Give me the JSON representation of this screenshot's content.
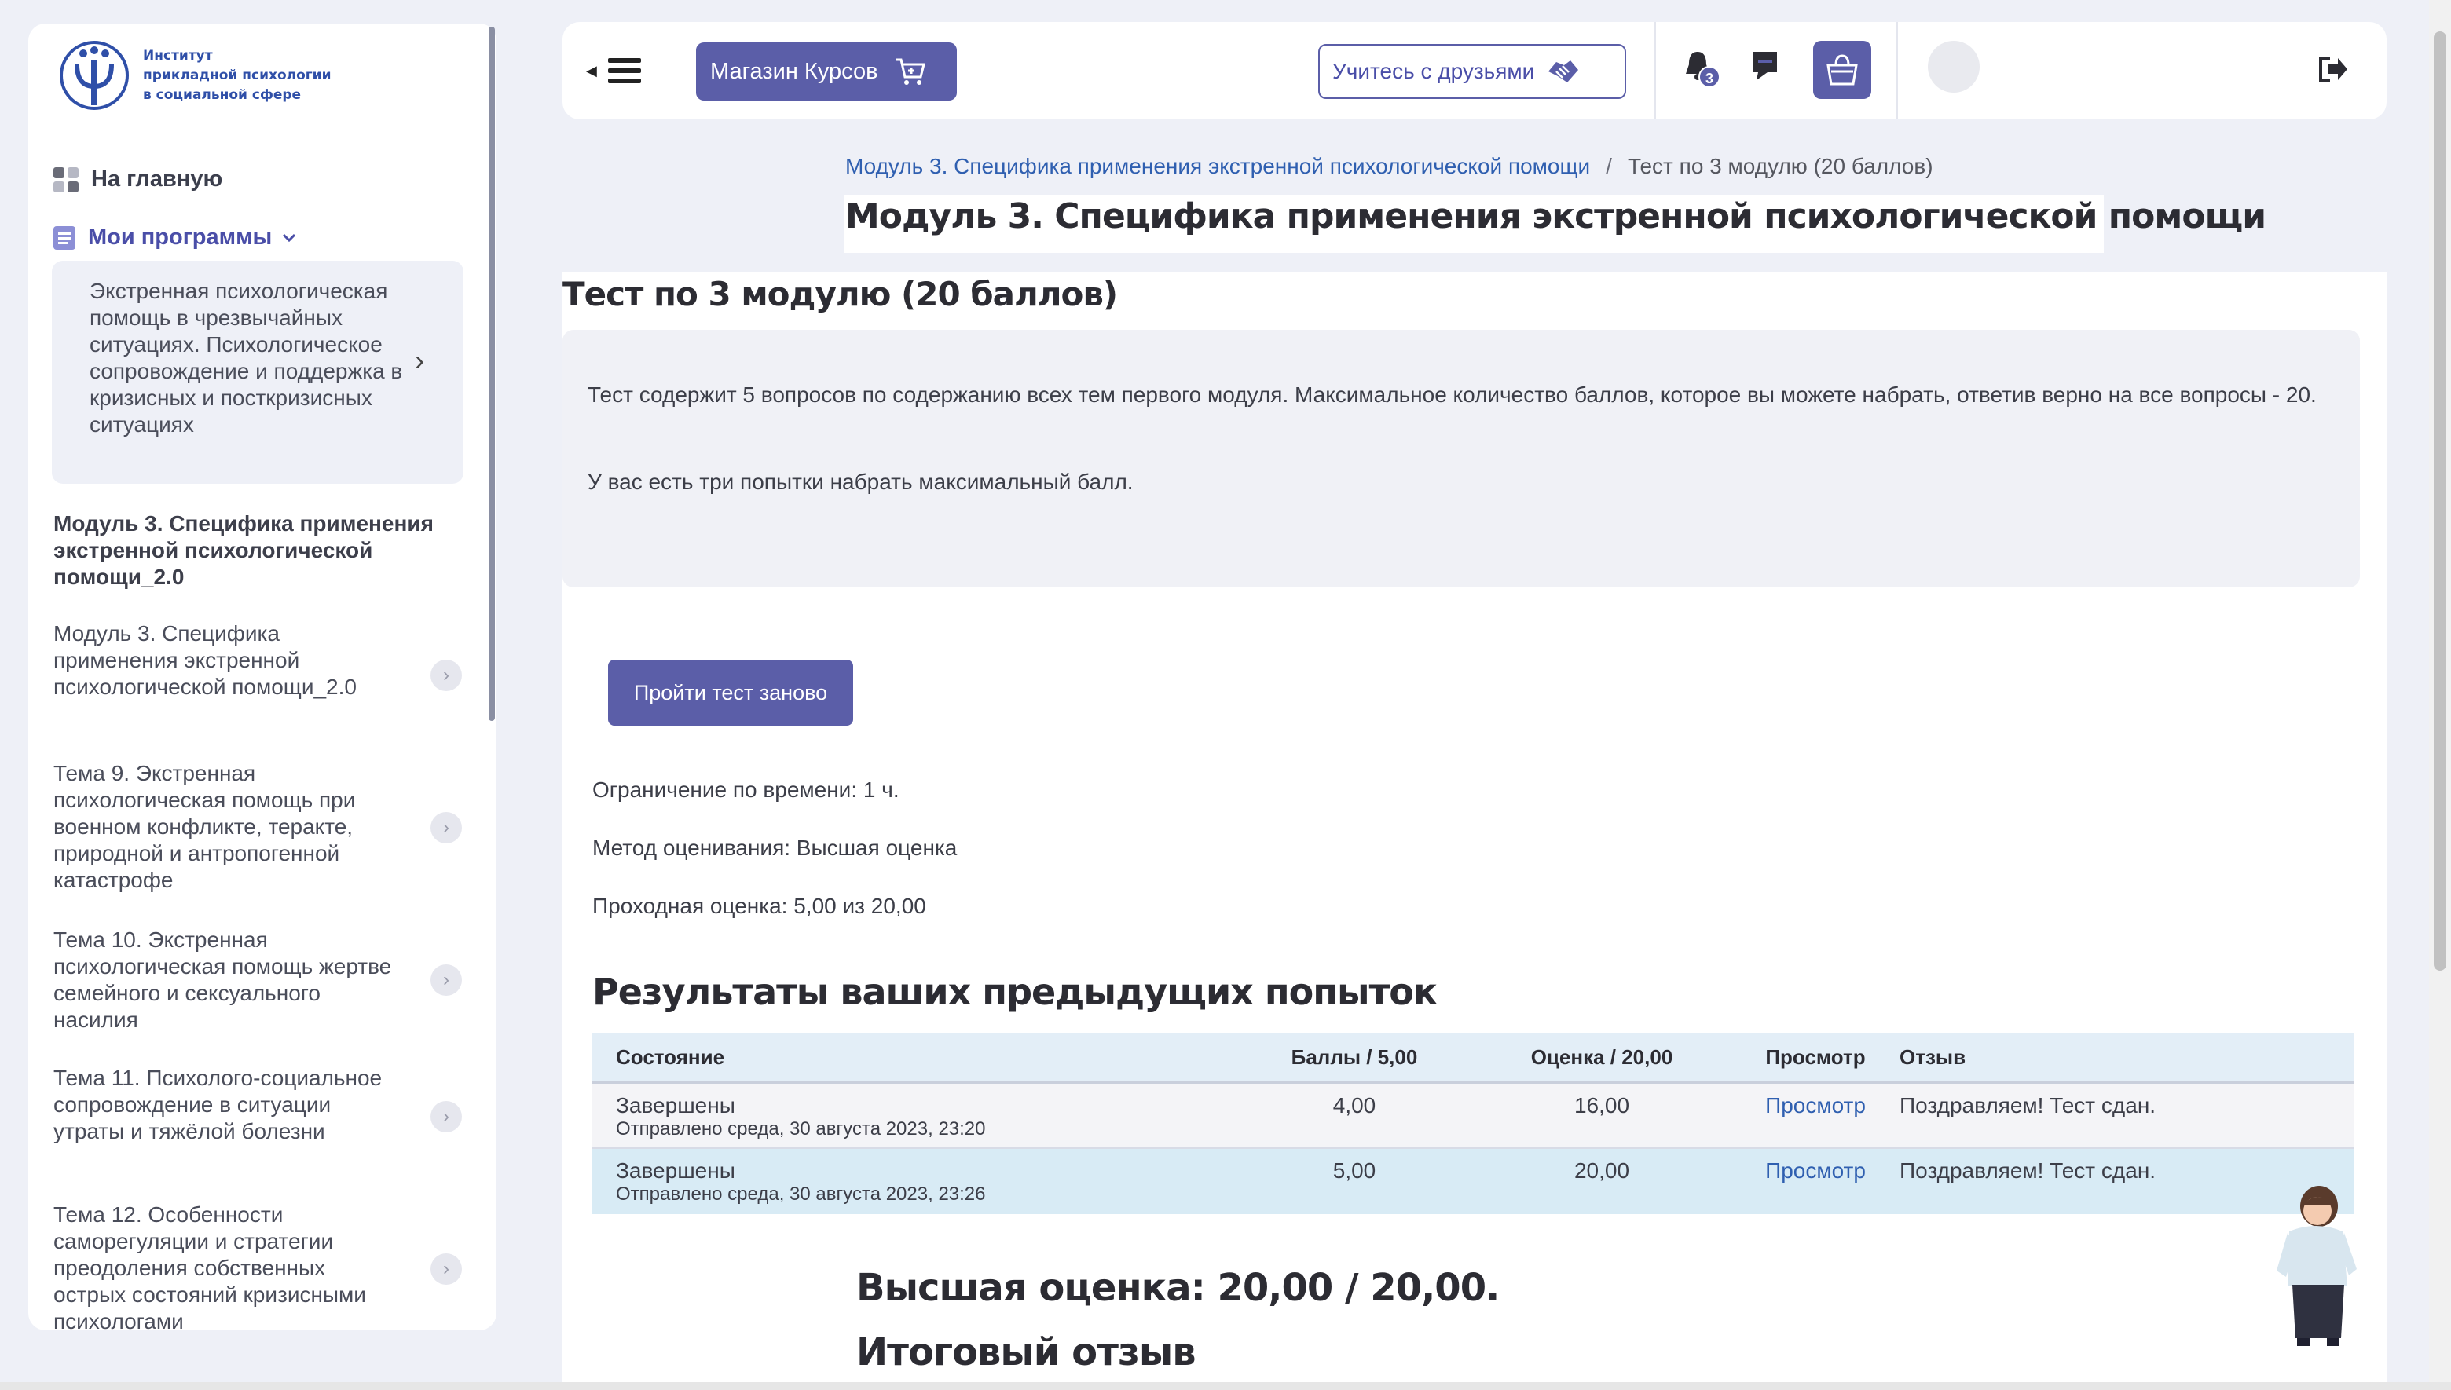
{
  "logo": {
    "lines": [
      "Институт",
      "прикладной психологии",
      "в социальной сфере"
    ]
  },
  "sidebar": {
    "home_label": "На главную",
    "programs_label": "Мои программы",
    "program_title": "Экстренная психологическая помощь в чрезвычайных ситуациях. Психологическое сопровождение и поддержка в кризисных и посткризисных ситуациях",
    "module_title": "Модуль 3. Специфика применения экстренной психологической помощи_2.0",
    "sections": [
      "Модуль 3. Специфика применения экстренной психологической помощи_2.0",
      "Тема 9. Экстренная психологическая помощь при военном конфликте, теракте, природной и антропогенной катастрофе",
      "Тема 10. Экстренная психологическая помощь жертве семейного и сексуального насилия",
      "Тема 11. Психолого-социальное сопровождение в ситуации утраты и тяжёлой болезни",
      "Тема 12. Особенности саморегуляции и стратегии преодоления собственных острых состояний кризисными психологами"
    ]
  },
  "header": {
    "shop_label": "Магазин Курсов",
    "friends_label": "Учитесь с друзьями",
    "notification_count": "3"
  },
  "breadcrumb": {
    "module": "Модуль 3. Специфика применения экстренной психологической помощи",
    "separator": "/",
    "current": "Тест по 3 модулю (20 баллов)"
  },
  "page": {
    "heading": "Модуль 3. Специфика применения экстренной психологической помощи",
    "quiz_title": "Тест по 3 модулю (20 баллов)",
    "intro_1": "Тест содержит 5 вопросов по содержанию всех тем первого модуля. Максимальное количество баллов, которое вы можете набрать, ответив верно на все вопросы - 20.",
    "intro_2": "У вас есть три попытки набрать максимальный балл.",
    "retake_label": "Пройти тест заново",
    "time_limit": "Ограничение по времени: 1 ч.",
    "grading_method": "Метод оценивания: Высшая оценка",
    "passing_grade": "Проходная оценка: 5,00 из 20,00",
    "results_heading": "Результаты ваших предыдущих попыток",
    "best_grade": "Высшая оценка: 20,00 / 20,00.",
    "final_feedback": "Итоговый отзыв"
  },
  "results": {
    "headers": [
      "Состояние",
      "Баллы / 5,00",
      "Оценка / 20,00",
      "Просмотр",
      "Отзыв"
    ],
    "rows": [
      {
        "state": "Завершены",
        "submitted": "Отправлено среда, 30 августа 2023, 23:20",
        "score": "4,00",
        "grade": "16,00",
        "review": "Просмотр",
        "feedback": "Поздравляем! Тест сдан."
      },
      {
        "state": "Завершены",
        "submitted": "Отправлено среда, 30 августа 2023, 23:26",
        "score": "5,00",
        "grade": "20,00",
        "review": "Просмотр",
        "feedback": "Поздравляем! Тест сдан."
      }
    ]
  },
  "colors": {
    "accent": "#5b5ea8",
    "link": "#2f5fb0",
    "background": "#eef0f7",
    "table_header": "#e3eef7",
    "highlight_row": "#d8ebf5"
  },
  "icons": [
    "logo-icon",
    "dashboard-icon",
    "document-icon",
    "chevron-down-icon",
    "chevron-right-icon",
    "hamburger-icon",
    "cart-icon",
    "handshake-icon",
    "bell-icon",
    "chat-icon",
    "basket-icon",
    "logout-icon"
  ]
}
